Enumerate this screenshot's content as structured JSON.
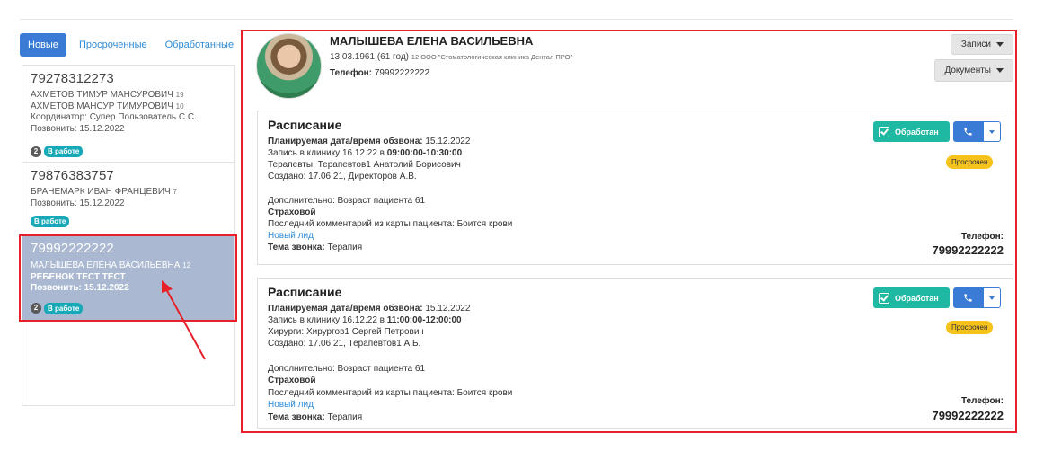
{
  "tabs": {
    "new": "Новые",
    "overdue": "Просроченные",
    "processed": "Обработанные"
  },
  "leads": [
    {
      "phone": "79278312273",
      "name1": "АХМЕТОВ ТИМУР МАНСУРОВИЧ",
      "age1": "19",
      "name2": "АХМЕТОВ МАНСУР ТИМУРОВИЧ",
      "age2": "10",
      "coordinator": "Координатор: Супер Пользователь С.С.",
      "call": "Позвонить: 15.12.2022",
      "count": "2",
      "status": "В работе"
    },
    {
      "phone": "79876383757",
      "name1": "БРАНЕМАРК ИВАН ФРАНЦЕВИЧ",
      "age1": "7",
      "call": "Позвонить: 15.12.2022",
      "status": "В работе"
    },
    {
      "phone": "79992222222",
      "name1": "МАЛЫШЕВА ЕЛЕНА ВАСИЛЬЕВНА",
      "age1": "12",
      "name2": "РЕБЕНОК ТЕСТ ТЕСТ",
      "call": "Позвонить: 15.12.2022",
      "count": "2",
      "status": "В работе"
    }
  ],
  "patient": {
    "name": "МАЛЫШЕВА ЕЛЕНА ВАСИЛЬЕВНА",
    "birth": "13.03.1961 (61 год)",
    "clinic": "12 ООО \"Стоматологическая клиника Дентал ПРО\"",
    "phone_label": "Телефон:",
    "phone": "79992222222"
  },
  "buttons": {
    "records": "Записи",
    "documents": "Документы",
    "processed": "Обработан",
    "overdue": "Просрочен"
  },
  "cards": [
    {
      "title": "Расписание",
      "planned_label": "Планируемая дата/время обзвона:",
      "planned_value": "15.12.2022",
      "visit_prefix": "Запись в клинику 16.12.22 в",
      "visit_time": "09:00:00-10:30:00",
      "doctors": "Терапевты: Терапевтов1 Анатолий Борисович",
      "created": "Создано: 17.06.21, Директоров А.В.",
      "extra": "Дополнительно: Возраст пациента 61",
      "insurance": "Страховой",
      "comment": "Последний комментарий из карты пациента: Боится крови",
      "link": "Новый лид",
      "topic_label": "Тема звонка:",
      "topic_value": "Терапия",
      "phone_label": "Телефон:",
      "phone": "79992222222"
    },
    {
      "title": "Расписание",
      "planned_label": "Планируемая дата/время обзвона:",
      "planned_value": "15.12.2022",
      "visit_prefix": "Запись в клинику 16.12.22 в",
      "visit_time": "11:00:00-12:00:00",
      "doctors": "Хирурги: Хирургов1 Сергей Петрович",
      "created": "Создано: 17.06.21, Терапевтов1 А.Б.",
      "extra": "Дополнительно: Возраст пациента 61",
      "insurance": "Страховой",
      "comment": "Последний комментарий из карты пациента: Боится крови",
      "link": "Новый лид",
      "topic_label": "Тема звонка:",
      "topic_value": "Терапия",
      "phone_label": "Телефон:",
      "phone": "79992222222"
    }
  ],
  "colors": {
    "accent_blue": "#3a7bd5",
    "link_blue": "#2e8bd6",
    "teal": "#1fb8a3",
    "badge_teal": "#18a9b8",
    "selected_bg": "#aab9d1",
    "warning_yellow": "#f6c21c",
    "highlight_red": "#e8202a"
  },
  "icons": {
    "call": "phone-icon",
    "check": "checkbox-icon",
    "dropdown": "caret-down-icon"
  }
}
